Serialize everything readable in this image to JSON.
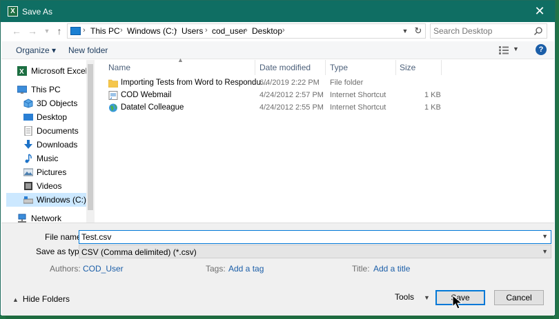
{
  "window": {
    "title": "Save As",
    "app_icon_letter": "X",
    "close_glyph": "✕"
  },
  "address": {
    "crumbs": [
      "This PC",
      "Windows (C:)",
      "Users",
      "cod_user",
      "Desktop"
    ]
  },
  "search": {
    "placeholder": "Search Desktop"
  },
  "toolbar": {
    "organize_label": "Organize ▾",
    "new_folder_label": "New folder",
    "help_label": "?"
  },
  "nav": {
    "items": [
      {
        "label": "Microsoft Excel",
        "icon": "excel-icon"
      },
      {
        "label": "This PC",
        "icon": "pc-icon"
      },
      {
        "label": "3D Objects",
        "icon": "3d-objects-icon"
      },
      {
        "label": "Desktop",
        "icon": "desktop-icon"
      },
      {
        "label": "Documents",
        "icon": "documents-icon"
      },
      {
        "label": "Downloads",
        "icon": "downloads-icon"
      },
      {
        "label": "Music",
        "icon": "music-icon"
      },
      {
        "label": "Pictures",
        "icon": "pictures-icon"
      },
      {
        "label": "Videos",
        "icon": "videos-icon"
      },
      {
        "label": "Windows (C:)",
        "icon": "drive-icon",
        "selected": true
      },
      {
        "label": "Network",
        "icon": "network-icon"
      }
    ]
  },
  "files": {
    "columns": [
      "Name",
      "Date modified",
      "Type",
      "Size"
    ],
    "rows": [
      {
        "name": "Importing Tests from Word to Respondu...",
        "date": "6/4/2019 2:22 PM",
        "type": "File folder",
        "size": "",
        "icon": "folder-icon"
      },
      {
        "name": "COD Webmail",
        "date": "4/24/2012 2:57 PM",
        "type": "Internet Shortcut",
        "size": "1 KB",
        "icon": "shortcut-icon"
      },
      {
        "name": "Datatel Colleague",
        "date": "4/24/2012 2:55 PM",
        "type": "Internet Shortcut",
        "size": "1 KB",
        "icon": "web-shortcut-icon"
      }
    ]
  },
  "form": {
    "file_name_label": "File name:",
    "file_name_value": "Test.csv",
    "save_type_label": "Save as type:",
    "save_type_value": "CSV (Comma delimited) (*.csv)",
    "authors_label": "Authors:",
    "authors_value": "COD_User",
    "tags_label": "Tags:",
    "tags_value": "Add a tag",
    "title_label": "Title:",
    "title_value": "Add a title"
  },
  "footer": {
    "hide_folders_label": "Hide Folders",
    "tools_label": "Tools",
    "save_label": "Save",
    "cancel_label": "Cancel"
  }
}
